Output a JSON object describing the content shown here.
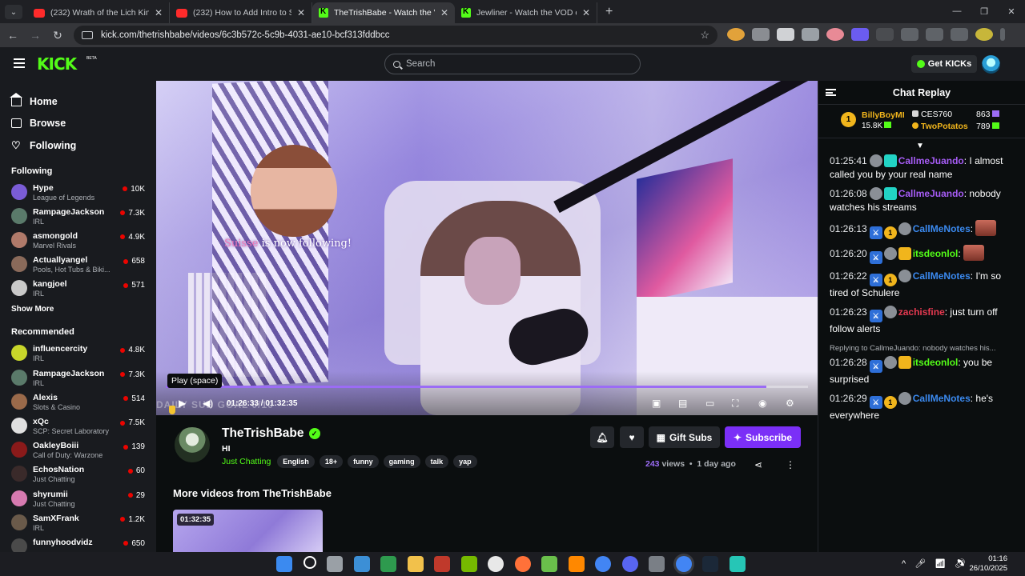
{
  "browser": {
    "tabs": [
      {
        "title": "(232) Wrath of the Lich King Sc",
        "favicon": "youtube-icon",
        "active": false
      },
      {
        "title": "(232) How to Add Intro to Strea",
        "favicon": "youtube-icon",
        "active": false
      },
      {
        "title": "TheTrishBabe - Watch the VOD",
        "favicon": "kick-icon",
        "active": true
      },
      {
        "title": "Jewliner - Watch the VOD on K",
        "favicon": "kick-icon",
        "active": false
      }
    ],
    "url": "kick.com/thetrishbabe/videos/6c3b572c-5c9b-4031-ae10-bcf313fddbcc"
  },
  "header": {
    "logo": "KICK",
    "beta": "BETA",
    "search_placeholder": "Search",
    "get_kicks": "Get KICKs"
  },
  "sidebar": {
    "nav": [
      {
        "label": "Home",
        "icon": "home-icon"
      },
      {
        "label": "Browse",
        "icon": "browse-icon"
      },
      {
        "label": "Following",
        "icon": "heart-icon"
      }
    ],
    "following_title": "Following",
    "following": [
      {
        "name": "Hype",
        "category": "League of Legends",
        "viewers": "10K",
        "color": "#7a5cd6"
      },
      {
        "name": "RampageJackson",
        "category": "IRL",
        "viewers": "7.3K",
        "color": "#5a7a6a"
      },
      {
        "name": "asmongold",
        "category": "Marvel Rivals",
        "viewers": "4.9K",
        "color": "#b07a6a"
      },
      {
        "name": "Actuallyangel",
        "category": "Pools, Hot Tubs & Biki...",
        "viewers": "658",
        "color": "#8a6a5a"
      },
      {
        "name": "kangjoel",
        "category": "IRL",
        "viewers": "571",
        "color": "#c9c9c9"
      }
    ],
    "show_more": "Show More",
    "recommended_title": "Recommended",
    "recommended": [
      {
        "name": "influencercity",
        "category": "IRL",
        "viewers": "4.8K",
        "color": "#c8d62a"
      },
      {
        "name": "RampageJackson",
        "category": "IRL",
        "viewers": "7.3K",
        "color": "#5a7a6a"
      },
      {
        "name": "Alexis",
        "category": "Slots & Casino",
        "viewers": "514",
        "color": "#9a6a4a"
      },
      {
        "name": "xQc",
        "category": "SCP: Secret Laboratory",
        "viewers": "7.5K",
        "color": "#e0e0e0"
      },
      {
        "name": "OakleyBoiii",
        "category": "Call of Duty: Warzone",
        "viewers": "139",
        "color": "#8a1a1a"
      },
      {
        "name": "EchosNation",
        "category": "Just Chatting",
        "viewers": "60",
        "color": "#3a2a2a"
      },
      {
        "name": "shyrumii",
        "category": "Just Chatting",
        "viewers": "29",
        "color": "#d67ab0"
      },
      {
        "name": "SamXFrank",
        "category": "IRL",
        "viewers": "1.2K",
        "color": "#6a5a4a"
      },
      {
        "name": "funnyhoodvidz",
        "category": "",
        "viewers": "650",
        "color": "#4a4a4a"
      }
    ]
  },
  "video": {
    "alert_name": "Suisse",
    "alert_text": " is now following!",
    "tooltip": "Play (space)",
    "current_time": "01:26:33",
    "duration": "01:32:35",
    "progress": 0.935
  },
  "stream": {
    "streamer": "TheTrishBabe",
    "title": "HI",
    "category": "Just Chatting",
    "tags": [
      "English",
      "18+",
      "funny",
      "gaming",
      "talk",
      "yap"
    ],
    "gift_subs": "Gift Subs",
    "subscribe": "Subscribe",
    "views_count": "243",
    "views_label": " views",
    "age": "1 day ago",
    "more_title": "More videos from TheTrishBabe",
    "thumb_duration": "01:32:35"
  },
  "chat": {
    "title": "Chat Replay",
    "gifters": {
      "top_rank": "1",
      "top_name": "BillyBoyMI",
      "top_count": "15.8K",
      "second_name": "CES760",
      "second_count": "863",
      "third_name": "TwoPotatos",
      "third_count": "789"
    },
    "messages": [
      {
        "time": "01:25:41",
        "user": "CallmeJuando",
        "text": ": I almost called you by your real name"
      },
      {
        "time": "01:26:08",
        "user": "CallmeJuando",
        "text": ": nobody watches his streams"
      },
      {
        "time": "01:26:13",
        "user": "CallMeNotes",
        "text": ":"
      },
      {
        "time": "01:26:20",
        "user": "itsdeonlol",
        "text": ":"
      },
      {
        "time": "01:26:22",
        "user": "CallMeNotes",
        "text": ": I'm so tired of Schulere"
      },
      {
        "time": "01:26:23",
        "user": "zachisfine",
        "text": ": just turn off follow alerts"
      },
      {
        "reply": "Replying to CallmeJuando: nobody watches his...",
        "time": "01:26:28",
        "user": "itsdeonlol",
        "text": ": you be surprised"
      },
      {
        "time": "01:26:29",
        "user": "CallMeNotes",
        "text": ": he's everywhere"
      }
    ]
  },
  "taskbar": {
    "time": "01:16",
    "date": "26/10/2025"
  }
}
